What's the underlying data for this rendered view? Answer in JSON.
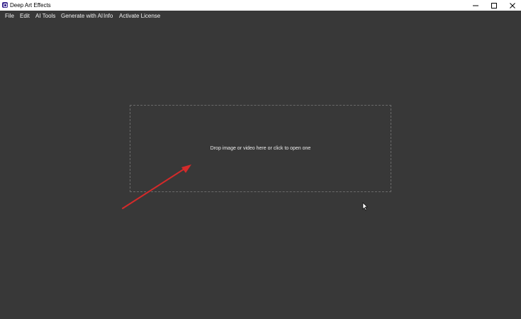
{
  "window": {
    "title": "Deep Art Effects"
  },
  "menu": {
    "file": "File",
    "edit": "Edit",
    "ai_tools": "AI Tools",
    "generate": "Generate with AI",
    "info": "Info",
    "activate": "Activate License"
  },
  "dropzone": {
    "text": "Drop image or video here or click to open one"
  },
  "colors": {
    "background": "#383838",
    "annotation_arrow": "#d42a2a",
    "dropzone_border": "#6a6a6a"
  },
  "icons": {
    "app": "app-logo-icon",
    "minimize": "minimize-icon",
    "maximize": "maximize-icon",
    "close": "close-icon",
    "cursor": "mouse-cursor-icon",
    "arrow": "red-arrow-annotation"
  }
}
